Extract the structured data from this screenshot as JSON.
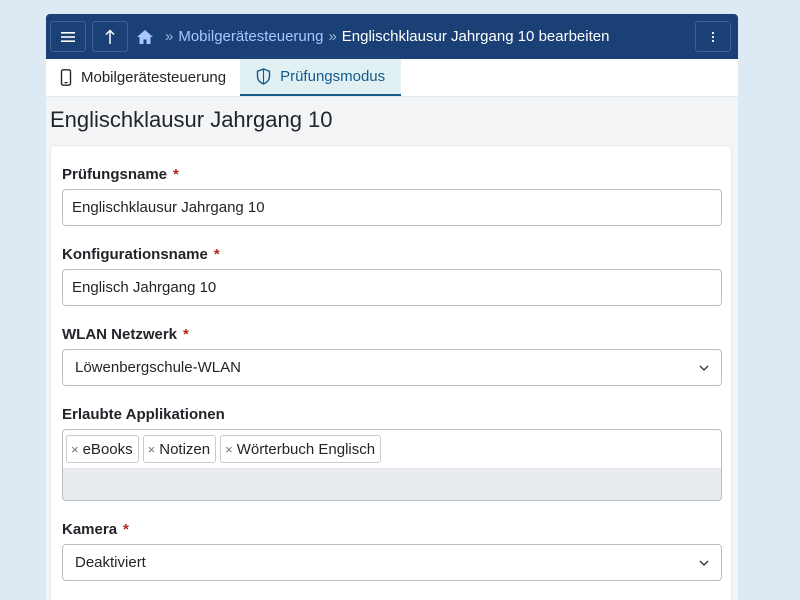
{
  "topbar": {
    "breadcrumbs": [
      {
        "label": "Mobilgerätesteuerung"
      },
      {
        "label": "Englischklausur Jahrgang 10 bearbeiten"
      }
    ],
    "separator": "»"
  },
  "tabs": [
    {
      "label": "Mobilgerätesteuerung",
      "icon": "smartphone-icon",
      "active": false
    },
    {
      "label": "Prüfungsmodus",
      "icon": "shield-icon",
      "active": true
    }
  ],
  "page_title": "Englischklausur Jahrgang 10",
  "form": {
    "required_marker": "*",
    "exam_name": {
      "label": "Prüfungsname",
      "value": "Englischklausur Jahrgang 10"
    },
    "config_name": {
      "label": "Konfigurationsname",
      "value": "Englisch Jahrgang 10"
    },
    "wifi": {
      "label": "WLAN Netzwerk",
      "value": "Löwenbergschule-WLAN"
    },
    "apps": {
      "label": "Erlaubte Applikationen",
      "remove_symbol": "×",
      "selected": [
        "eBooks",
        "Notizen",
        "Wörterbuch Englisch"
      ]
    },
    "camera": {
      "label": "Kamera",
      "value": "Deaktiviert"
    }
  },
  "colors": {
    "topbar_bg": "#1b4076",
    "link": "#a9c7ff",
    "active_tab_bg": "#e0f0f3",
    "active_tab_text": "#155a8a",
    "required": "#b3261e",
    "page_bg": "#dde9f3"
  }
}
